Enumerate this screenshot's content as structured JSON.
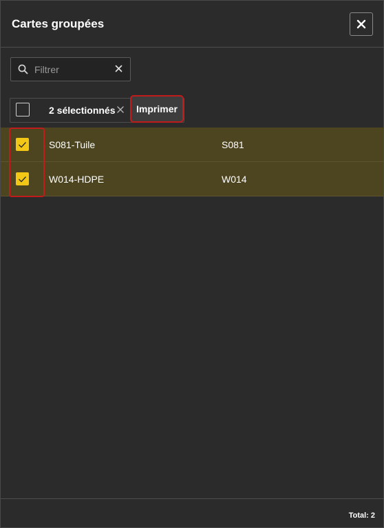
{
  "dialog": {
    "title": "Cartes groupées"
  },
  "icons": {
    "close": "close-icon",
    "search": "search-icon",
    "clear": "clear-icon",
    "check": "check-icon"
  },
  "filter": {
    "placeholder": "Filtrer",
    "value": ""
  },
  "selection": {
    "count_label": "2 sélectionnés",
    "print_label": "Imprimer"
  },
  "rows": [
    {
      "name": "S081-Tuile",
      "code": "S081",
      "checked": true
    },
    {
      "name": "W014-HDPE",
      "code": "W014",
      "checked": true
    }
  ],
  "footer": {
    "total_label": "Total: 2"
  },
  "colors": {
    "accent": "#f3c716",
    "selected_row": "#4d4520",
    "highlight": "#c21b1b"
  }
}
